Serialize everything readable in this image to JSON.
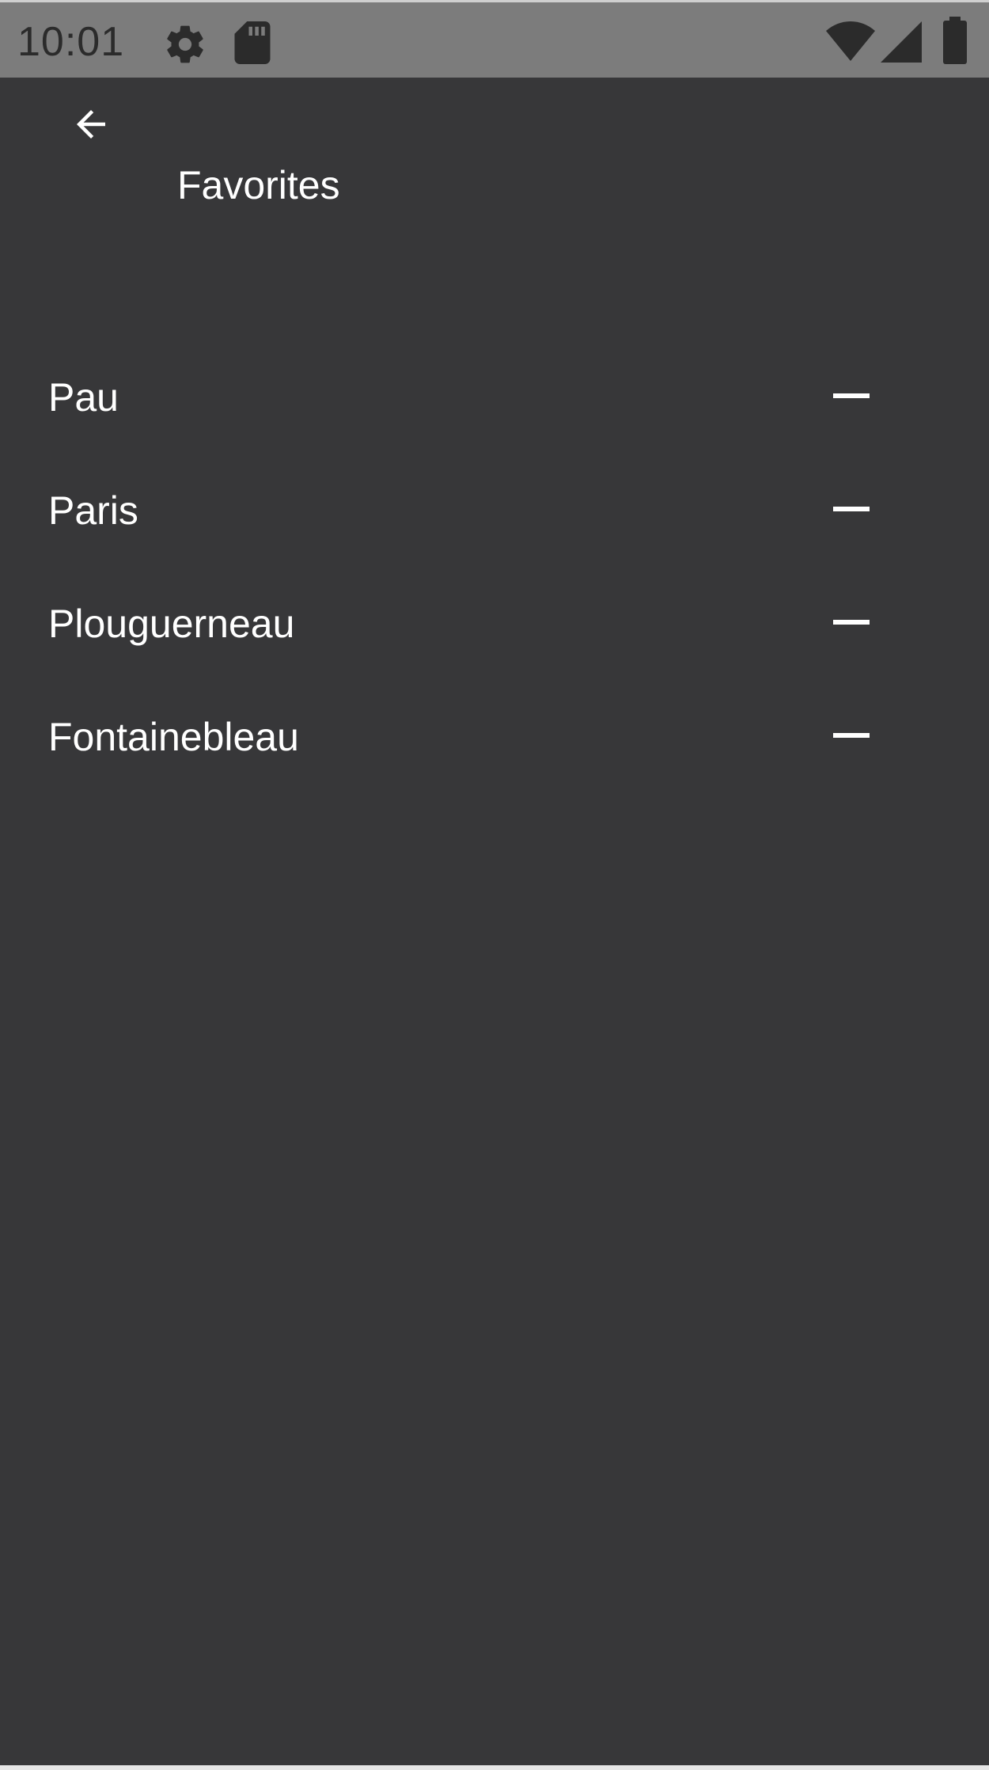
{
  "status_bar": {
    "time": "10:01",
    "icons": [
      "gear-icon",
      "sd-card-icon",
      "wifi-icon",
      "cell-signal-icon",
      "battery-icon"
    ]
  },
  "app_bar": {
    "back_icon": "arrow-back-icon",
    "title": "Favorites"
  },
  "favorites": [
    {
      "name": "Pau",
      "action_icon": "minus-icon"
    },
    {
      "name": "Paris",
      "action_icon": "minus-icon"
    },
    {
      "name": "Plouguerneau",
      "action_icon": "minus-icon"
    },
    {
      "name": "Fontainebleau",
      "action_icon": "minus-icon"
    }
  ],
  "colors": {
    "background": "#373739",
    "status_bar": "#7c7c7c",
    "status_icons": "#2b2b2b",
    "text": "#ffffff"
  }
}
